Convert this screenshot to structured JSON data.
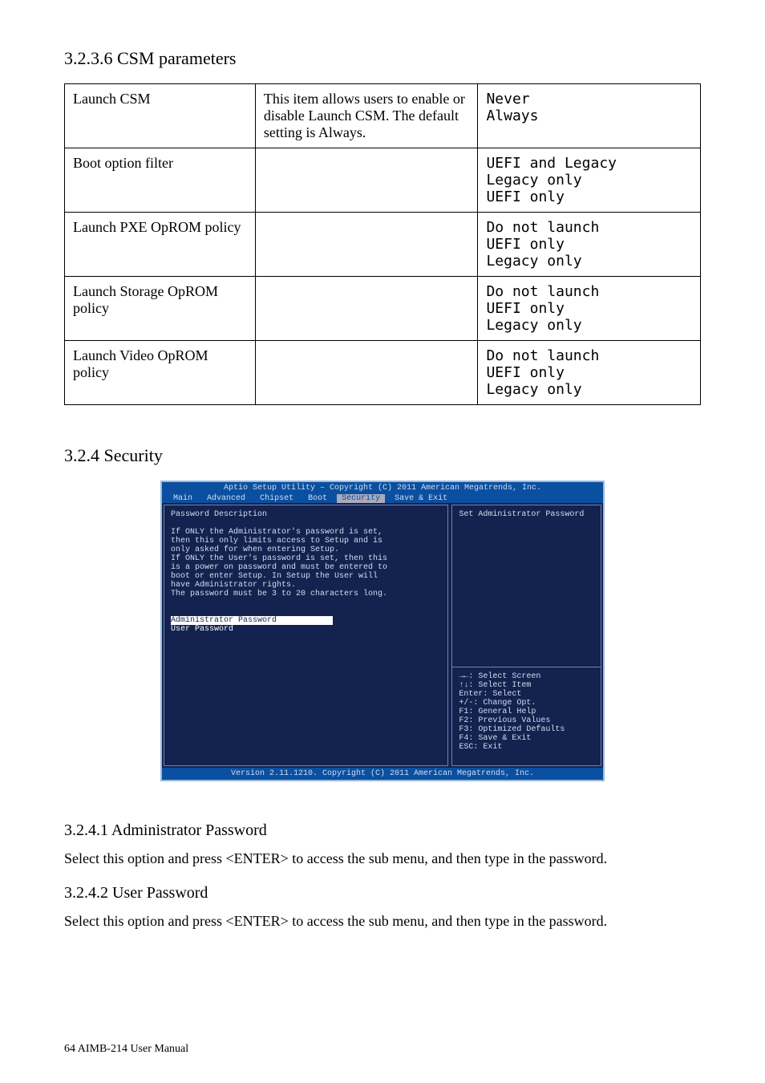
{
  "page": {
    "footer_left": "64                                                                                                      AIMB-214 User Manual",
    "footer_right": ""
  },
  "section_csm": {
    "title": "3.2.3.6 CSM parameters"
  },
  "table_csm": [
    {
      "c1": "Launch CSM",
      "c2": "This item allows users to enable or disable Launch CSM. The default setting is Always.",
      "c3": "Never\nAlways"
    },
    {
      "c1": "Boot option filter",
      "c2": "",
      "c3": "UEFI and Legacy\nLegacy only\nUEFI only"
    },
    {
      "c1": "Launch PXE OpROM policy",
      "c2": "",
      "c3": "Do not launch\nUEFI only\nLegacy only"
    },
    {
      "c1": "Launch Storage OpROM policy",
      "c2": "",
      "c3": "Do not launch\nUEFI only\nLegacy only"
    },
    {
      "c1": "Launch Video OpROM policy",
      "c2": "",
      "c3": "Do not launch\nUEFI only\nLegacy only"
    }
  ],
  "section_sec": {
    "title": "3.2.4 Security"
  },
  "bios": {
    "header": "Aptio Setup Utility – Copyright (C) 2011 American Megatrends, Inc.",
    "tabs": [
      "Main",
      "Advanced",
      "Chipset",
      "Boot",
      "Security",
      "Save & Exit"
    ],
    "tab_selected": 4,
    "desc_title": "Password Description",
    "desc_lines": [
      "If ONLY the Administrator's password is set,",
      "then this only limits access to Setup and is",
      "only asked for when entering Setup.",
      "If ONLY the User's password is set, then this",
      "is a power on password and must be entered to",
      "boot or enter Setup. In Setup the User will",
      "have Administrator rights.",
      "The password must be 3 to 20 characters long."
    ],
    "items": [
      "Administrator Password",
      "User Password"
    ],
    "item_selected": 0,
    "help_top": "Set Administrator Password",
    "help_keys": [
      "→←: Select Screen",
      "↑↓: Select Item",
      "Enter: Select",
      "+/-: Change Opt.",
      "F1: General Help",
      "F2: Previous Values",
      "F3: Optimized Defaults",
      "F4: Save & Exit",
      "ESC: Exit"
    ],
    "footer": "Version 2.11.1210. Copyright (C) 2011 American Megatrends, Inc."
  },
  "section_admin": {
    "title": "3.2.4.1 Administrator Password",
    "text": "Select this option and press <ENTER> to access the sub menu, and then type in the password."
  },
  "section_user": {
    "title": "3.2.4.2 User Password",
    "text": "Select this option and press <ENTER> to access the sub menu, and then type in the password."
  }
}
